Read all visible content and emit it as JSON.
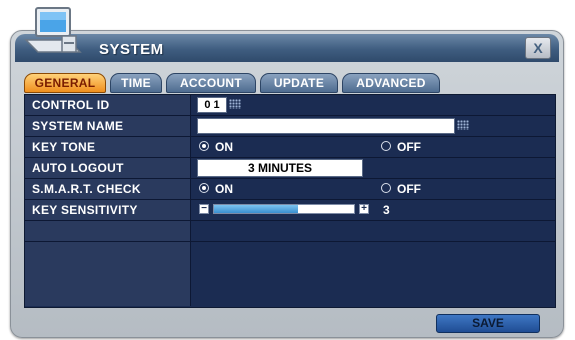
{
  "window": {
    "title": "SYSTEM",
    "close_label": "X"
  },
  "tabs": [
    {
      "label": "GENERAL",
      "active": true
    },
    {
      "label": "TIME"
    },
    {
      "label": "ACCOUNT"
    },
    {
      "label": "UPDATE"
    },
    {
      "label": "ADVANCED"
    }
  ],
  "fields": {
    "control_id": {
      "label": "CONTROL ID",
      "value": "0 1"
    },
    "system_name": {
      "label": "SYSTEM NAME",
      "value": ""
    },
    "key_tone": {
      "label": "KEY TONE",
      "on": "ON",
      "off": "OFF",
      "selected": "ON"
    },
    "auto_logout": {
      "label": "AUTO LOGOUT",
      "value": "3 MINUTES"
    },
    "smart_check": {
      "label": "S.M.A.R.T. CHECK",
      "on": "ON",
      "off": "OFF",
      "selected": "ON"
    },
    "key_sensitivity": {
      "label": "KEY SENSITIVITY",
      "value": "3",
      "level": 0.6
    }
  },
  "footer": {
    "save_label": "SAVE"
  },
  "icons": [
    "monitor-icon",
    "close-icon",
    "keypad-icon",
    "minus-icon",
    "plus-icon"
  ]
}
